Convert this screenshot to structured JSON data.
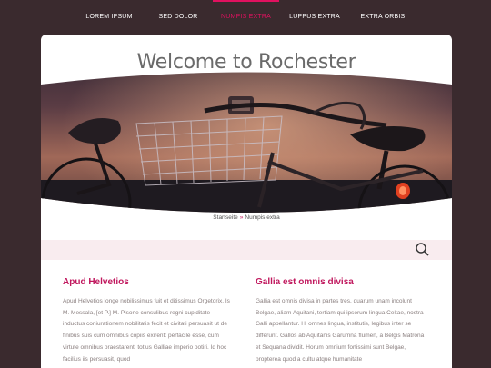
{
  "nav": {
    "items": [
      {
        "label": "LOREM IPSUM",
        "active": false
      },
      {
        "label": "SED DOLOR",
        "active": false
      },
      {
        "label": "NUMPIS EXTRA",
        "active": true
      },
      {
        "label": "LUPPUS EXTRA",
        "active": false
      },
      {
        "label": "EXTRA ORBIS",
        "active": false
      }
    ]
  },
  "page": {
    "title": "Welcome to Rochester"
  },
  "breadcrumb": {
    "home": "Startseite",
    "separator": "»",
    "current": "Numpis extra"
  },
  "search": {
    "icon": "search-icon"
  },
  "columns": [
    {
      "heading": "Apud Helvetios",
      "text": "Apud Helvetios longe nobilissimus fuit et ditissimus Orgetorix. Is M. Messala, [et P.] M. Pisone consulibus regni cupiditate inductus coniurationem nobilitatis fecit et civitati persuasit ut de finibus suis cum omnibus copiis exirent: perfacile esse, cum virtute omnibus praestarent, totius Galliae imperio potiri. Id hoc facilius iis persuasit, quod"
    },
    {
      "heading": "Gallia est omnis divisa",
      "text": "Gallia est omnis divisa in partes tres, quarum unam incolunt Belgae, aliam Aquitani, tertiam qui ipsorum lingua Celtae, nostra Galli appellantur. Hi omnes lingua, institutis, legibus inter se differunt. Gallos ab Aquitanis Garumna flumen, a Belgis Matrona et Sequana dividit. Horum omnium fortissimi sunt Belgae, propterea quod a cultu atque humanitate"
    }
  ],
  "colors": {
    "accent": "#c0175d",
    "nav_active": "#e0115f",
    "background": "#3a2a2e",
    "search_bar": "#f9ecef"
  }
}
